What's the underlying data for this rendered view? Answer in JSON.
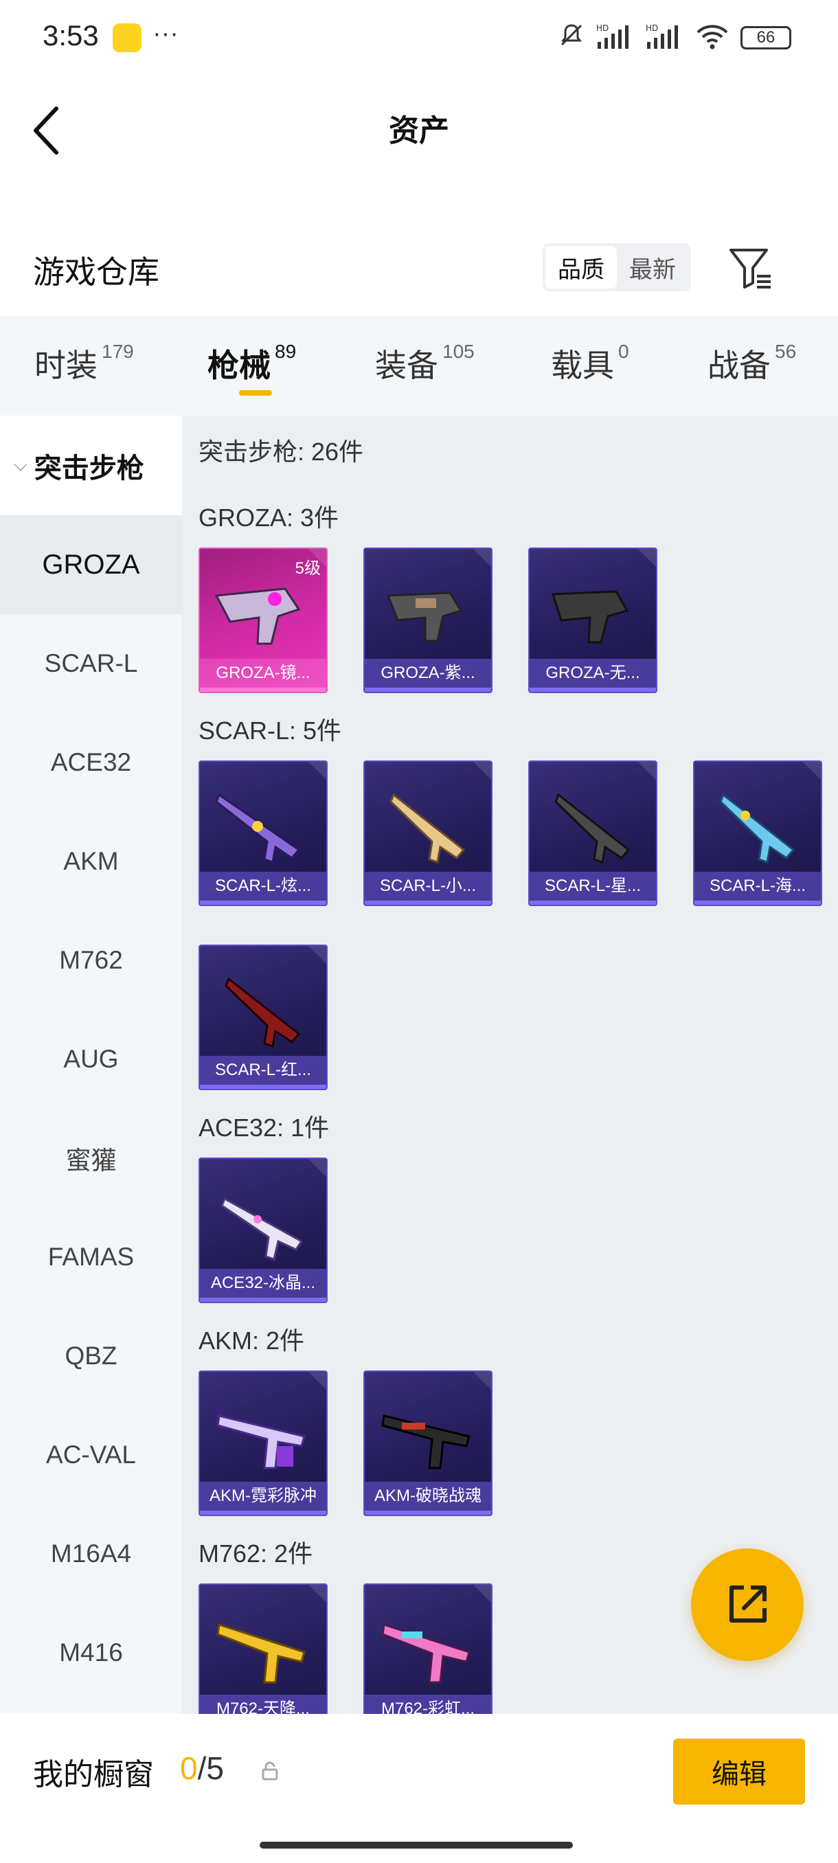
{
  "status": {
    "time": "3:53",
    "dots": "···",
    "battery": "66",
    "icons": [
      "mute-icon",
      "signal-hd-icon",
      "signal-hd-icon",
      "wifi-icon",
      "battery-icon"
    ]
  },
  "header": {
    "title": "资产"
  },
  "section": {
    "title": "游戏仓库",
    "sort_options": [
      "品质",
      "最新"
    ],
    "sort_selected": "品质"
  },
  "tabs": [
    {
      "label": "时装",
      "count": "179"
    },
    {
      "label": "枪械",
      "count": "89"
    },
    {
      "label": "装备",
      "count": "105"
    },
    {
      "label": "载具",
      "count": "0"
    },
    {
      "label": "战备",
      "count": "56"
    }
  ],
  "active_tab": "枪械",
  "sidebar": {
    "group": "突击步枪",
    "items": [
      "GROZA",
      "SCAR-L",
      "ACE32",
      "AKM",
      "M762",
      "AUG",
      "蜜獾",
      "FAMAS",
      "QBZ",
      "AC-VAL",
      "M16A4",
      "M416"
    ],
    "active": "GROZA"
  },
  "content": {
    "summary": "突击步枪: 26件",
    "groups": [
      {
        "label": "GROZA: 3件",
        "items": [
          {
            "name": "GROZA-镜...",
            "level": "5级",
            "style": "pink"
          },
          {
            "name": "GROZA-紫...",
            "style": "purple"
          },
          {
            "name": "GROZA-无...",
            "style": "purple"
          }
        ]
      },
      {
        "label": "SCAR-L: 5件",
        "items": [
          {
            "name": "SCAR-L-炫...",
            "style": "purple"
          },
          {
            "name": "SCAR-L-小...",
            "style": "purple"
          },
          {
            "name": "SCAR-L-星...",
            "style": "purple"
          },
          {
            "name": "SCAR-L-海...",
            "style": "purple"
          },
          {
            "name": "SCAR-L-红...",
            "style": "purple"
          }
        ]
      },
      {
        "label": "ACE32: 1件",
        "items": [
          {
            "name": "ACE32-冰晶...",
            "style": "purple"
          }
        ]
      },
      {
        "label": "AKM: 2件",
        "items": [
          {
            "name": "AKM-霓彩脉冲",
            "style": "purple"
          },
          {
            "name": "AKM-破晓战魂",
            "style": "purple"
          }
        ]
      },
      {
        "label": "M762: 2件",
        "items": [
          {
            "name": "M762-天降...",
            "style": "purple"
          },
          {
            "name": "M762-彩虹...",
            "style": "purple"
          }
        ]
      }
    ]
  },
  "bottom": {
    "showcase_label": "我的橱窗",
    "showcase_current": "0",
    "showcase_total": "/5",
    "edit_label": "编辑"
  },
  "colors": {
    "accent": "#f7b500",
    "card_bg": "#2a2266",
    "card_rare": "#d42aa6"
  }
}
